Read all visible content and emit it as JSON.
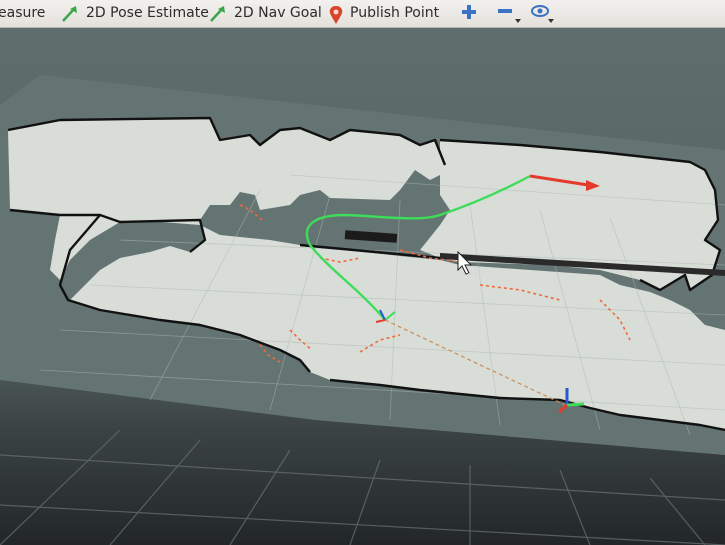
{
  "toolbar": {
    "tools": [
      {
        "id": "measure",
        "label": "easure",
        "icon": "ruler-icon"
      },
      {
        "id": "pose",
        "label": "2D Pose Estimate",
        "icon": "green-arrow-icon"
      },
      {
        "id": "nav",
        "label": "2D Nav Goal",
        "icon": "green-arrow-icon"
      },
      {
        "id": "publish",
        "label": "Publish Point",
        "icon": "map-pin-icon"
      }
    ],
    "extra_icons": [
      "plus-icon",
      "minus-icon",
      "eye-icon"
    ]
  },
  "colors": {
    "toolbar_bg": "#ebe8e4",
    "map_free": "#d9ddd7",
    "map_unknown": "#5f6e6d",
    "map_wall": "#111111",
    "path": "#3ddc5a",
    "goal_arrow": "#e53b2c",
    "laser": "#f06a3a",
    "grid": "#b9c2c0"
  }
}
